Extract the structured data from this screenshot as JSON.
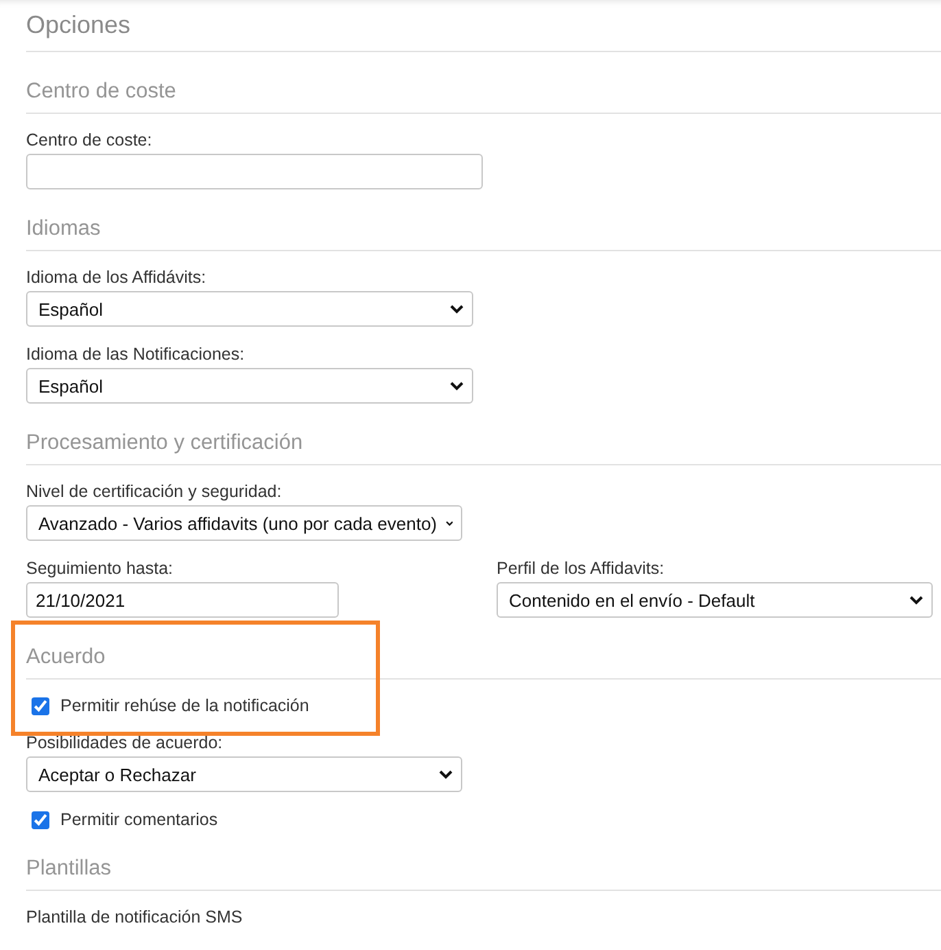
{
  "page_title": "Opciones",
  "sections": [
    {
      "title": "Centro de coste",
      "fields": [
        {
          "kind": "text",
          "label": "Centro de coste:"
        }
      ]
    },
    {
      "title": "Idiomas",
      "fields": [
        {
          "kind": "select",
          "label": "Idioma de los Affidávits:",
          "value": "Español"
        },
        {
          "kind": "select",
          "label": "Idioma de las Notificaciones:",
          "value": "Español"
        }
      ]
    },
    {
      "title": "Procesamiento y certificación",
      "fields": [
        {
          "kind": "select",
          "label": "Nivel de certificación y seguridad:",
          "value": "Avanzado - Varios affidavits (uno por cada evento)"
        },
        {
          "kind": "pair",
          "fields": [
            {
              "kind": "text",
              "label": "Seguimiento hasta:",
              "value": "21/10/2021"
            },
            {
              "kind": "select",
              "label": "Perfil de los Affidavits:",
              "value": "Contenido en el envío - Default"
            }
          ]
        }
      ]
    },
    {
      "title": "Acuerdo",
      "highlighted": true,
      "fields": [
        {
          "kind": "checkbox",
          "label": "Permitir rehúse de la notificación",
          "checked": true
        },
        {
          "kind": "select",
          "label": "Posibilidades de acuerdo:",
          "value": "Aceptar o Rechazar"
        },
        {
          "kind": "checkbox",
          "label": "Permitir comentarios",
          "checked": true
        }
      ]
    },
    {
      "title": "Plantillas",
      "fields": [
        {
          "kind": "label",
          "label": "Plantilla de notificación SMS"
        }
      ]
    }
  ]
}
